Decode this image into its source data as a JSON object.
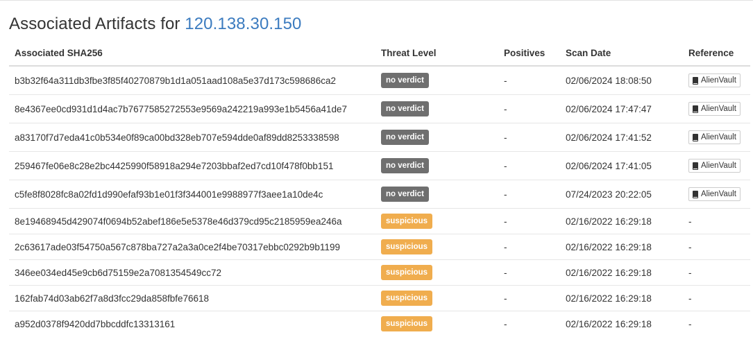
{
  "title": {
    "prefix": "Associated Artifacts for ",
    "ip": "120.138.30.150"
  },
  "table": {
    "headers": {
      "sha": "Associated SHA256",
      "threat": "Threat Level",
      "positives": "Positives",
      "date": "Scan Date",
      "reference": "Reference"
    },
    "rows": [
      {
        "sha": "b3b32f64a311db3fbe3f85f40270879b1d1a051aad108a5e37d173c598686ca2",
        "threat": "no verdict",
        "positives": "-",
        "date": "02/06/2024 18:08:50",
        "reference": "AlienVault"
      },
      {
        "sha": "8e4367ee0cd931d1d4ac7b7677585272553e9569a242219a993e1b5456a41de7",
        "threat": "no verdict",
        "positives": "-",
        "date": "02/06/2024 17:47:47",
        "reference": "AlienVault"
      },
      {
        "sha": "a83170f7d7eda41c0b534e0f89ca00bd328eb707e594dde0af89dd8253338598",
        "threat": "no verdict",
        "positives": "-",
        "date": "02/06/2024 17:41:52",
        "reference": "AlienVault"
      },
      {
        "sha": "259467fe06e8c28e2bc4425990f58918a294e7203bbaf2ed7cd10f478f0bb151",
        "threat": "no verdict",
        "positives": "-",
        "date": "02/06/2024 17:41:05",
        "reference": "AlienVault"
      },
      {
        "sha": "c5fe8f8028fc8a02fd1d990efaf93b1e01f3f344001e9988977f3aee1a10de4c",
        "threat": "no verdict",
        "positives": "-",
        "date": "07/24/2023 20:22:05",
        "reference": "AlienVault"
      },
      {
        "sha": "8e19468945d429074f0694b52abef186e5e5378e46d379cd95c2185959ea246a",
        "threat": "suspicious",
        "positives": "-",
        "date": "02/16/2022 16:29:18",
        "reference": "-"
      },
      {
        "sha": "2c63617ade03f54750a567c878ba727a2a3a0ce2f4be70317ebbc0292b9b1199",
        "threat": "suspicious",
        "positives": "-",
        "date": "02/16/2022 16:29:18",
        "reference": "-"
      },
      {
        "sha": "346ee034ed45e9cb6d75159e2a7081354549cc72",
        "threat": "suspicious",
        "positives": "-",
        "date": "02/16/2022 16:29:18",
        "reference": "-"
      },
      {
        "sha": "162fab74d03ab62f7a8d3fcc29da858fbfe76618",
        "threat": "suspicious",
        "positives": "-",
        "date": "02/16/2022 16:29:18",
        "reference": "-"
      },
      {
        "sha": "a952d0378f9420dd7bbcddfc13313161",
        "threat": "suspicious",
        "positives": "-",
        "date": "02/16/2022 16:29:18",
        "reference": "-"
      }
    ]
  },
  "colors": {
    "link": "#3b7bbf",
    "no_verdict": "#6f6f6f",
    "suspicious": "#f0ad4e"
  },
  "icons": {
    "reference": "book-icon"
  }
}
